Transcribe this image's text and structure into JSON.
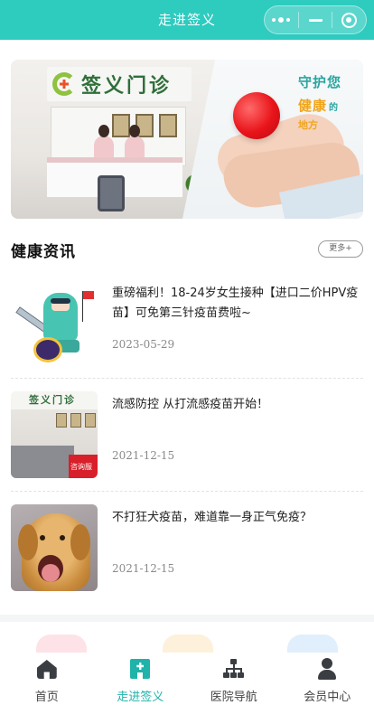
{
  "header": {
    "title": "走进签义"
  },
  "capsule": {
    "more_icon": "more-dots-icon",
    "minimize_icon": "minimize-icon",
    "close_icon": "target-circle-icon"
  },
  "banner": {
    "clinic_name": "签义门诊",
    "slogan_line1": "守护您",
    "slogan_line2": "健康",
    "slogan_line2_suffix": "的",
    "slogan_line3": "地方"
  },
  "news_section": {
    "title": "健康资讯",
    "more_label": "更多+"
  },
  "news": [
    {
      "title": "重磅福利！18-24岁女生接种【进口二价HPV疫苗】可免第三针疫苗费啦~",
      "date": "2023-05-29",
      "thumb": "cartoon-doctor-vaccine"
    },
    {
      "title": "流感防控 从打流感疫苗开始！",
      "date": "2021-12-15",
      "thumb": "clinic-photo",
      "thumb_sign": "签义门诊",
      "thumb_panel": "咨询服"
    },
    {
      "title": "不打狂犬疫苗，难道靠一身正气免疫？",
      "date": "2021-12-15",
      "thumb": "dog-photo"
    }
  ],
  "tabbar": {
    "items": [
      {
        "label": "首页",
        "icon": "home-icon",
        "active": false
      },
      {
        "label": "走进签义",
        "icon": "hospital-icon",
        "active": true
      },
      {
        "label": "医院导航",
        "icon": "org-tree-icon",
        "active": false
      },
      {
        "label": "会员中心",
        "icon": "user-icon",
        "active": false
      }
    ]
  },
  "colors": {
    "brand": "#2ecbbf",
    "active_tab": "#1fb3a9",
    "date": "#8a8a8a"
  }
}
